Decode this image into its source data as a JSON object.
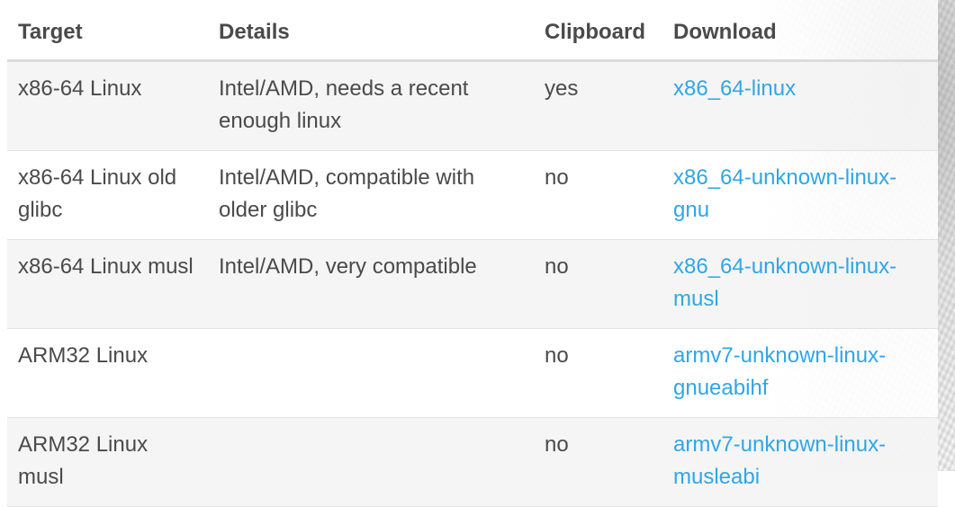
{
  "table": {
    "headers": [
      "Target",
      "Details",
      "Clipboard",
      "Download"
    ],
    "rows": [
      {
        "target": "x86-64 Linux",
        "details": "Intel/AMD, needs a recent enough linux",
        "clipboard": "yes",
        "download": "x86_64-linux"
      },
      {
        "target": "x86-64 Linux old glibc",
        "details": "Intel/AMD, compatible with older glibc",
        "clipboard": "no",
        "download": "x86_64-unknown-linux-gnu"
      },
      {
        "target": "x86-64 Linux musl",
        "details": "Intel/AMD, very compatible",
        "clipboard": "no",
        "download": "x86_64-unknown-linux-musl"
      },
      {
        "target": "ARM32 Linux",
        "details": "",
        "clipboard": "no",
        "download": "armv7-unknown-linux-gnueabihf"
      },
      {
        "target": "ARM32 Linux musl",
        "details": "",
        "clipboard": "no",
        "download": "armv7-unknown-linux-musleabi"
      }
    ]
  },
  "colors": {
    "text": "#4a4a4a",
    "link": "#30a6e6",
    "row_odd": "#f5f5f5",
    "row_even": "#ffffff",
    "header_rule": "#dcdcdc"
  }
}
